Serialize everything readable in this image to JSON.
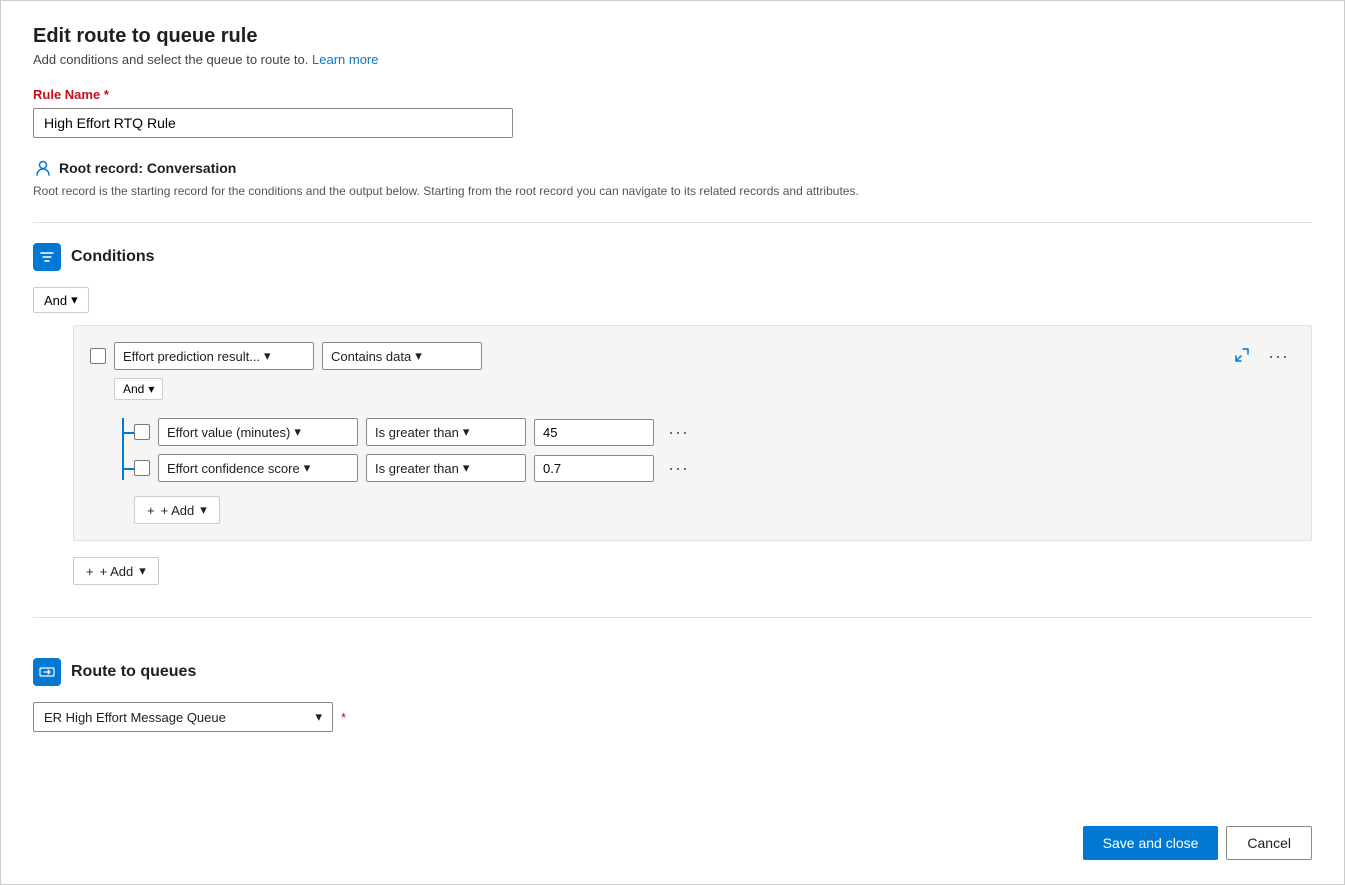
{
  "page": {
    "title": "Edit route to queue rule",
    "subtitle": "Add conditions and select the queue to route to.",
    "learn_more": "Learn more"
  },
  "rule_name": {
    "label": "Rule Name",
    "required": "*",
    "value": "High Effort RTQ Rule"
  },
  "root_record": {
    "label": "Root record:",
    "value": "Conversation",
    "description": "Root record is the starting record for the conditions and the output below. Starting from the root record you can navigate to its related records and attributes."
  },
  "conditions_section": {
    "title": "Conditions",
    "and_label": "And",
    "outer_condition": {
      "field": "Effort prediction result...",
      "operator": "Contains data"
    },
    "inner_and_label": "And",
    "sub_conditions": [
      {
        "field": "Effort value (minutes)",
        "operator": "Is greater than",
        "value": "45"
      },
      {
        "field": "Effort confidence score",
        "operator": "Is greater than",
        "value": "0.7"
      }
    ],
    "add_label": "+ Add",
    "outer_add_label": "+ Add"
  },
  "route_section": {
    "title": "Route to queues",
    "queue_value": "ER High Effort Message Queue",
    "required": "*"
  },
  "footer": {
    "save_label": "Save and close",
    "cancel_label": "Cancel"
  }
}
